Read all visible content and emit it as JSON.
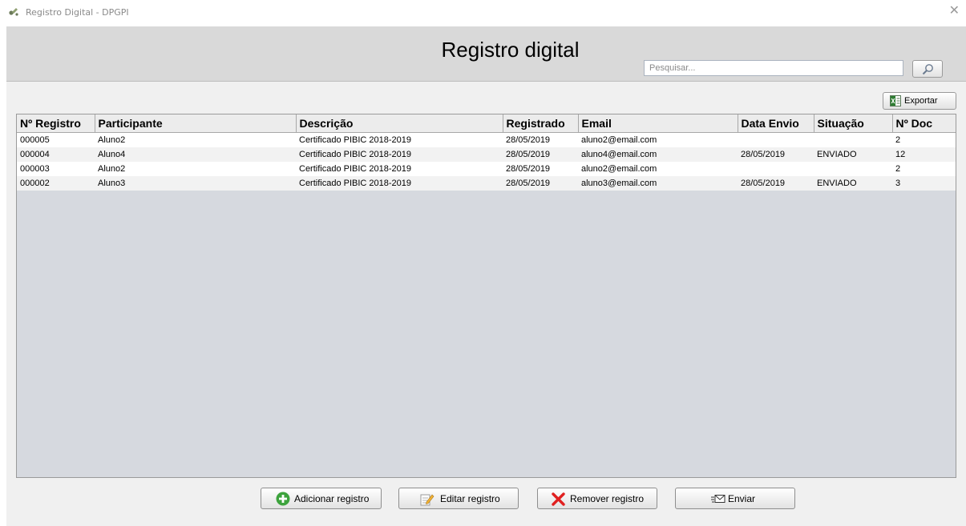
{
  "window": {
    "title": "Registro Digital - DPGPI",
    "heading": "Registro digital"
  },
  "search": {
    "placeholder": "Pesquisar...",
    "value": ""
  },
  "toolbar": {
    "export_label": "Exportar"
  },
  "table": {
    "columns": [
      "Nº Registro",
      "Participante",
      "Descrição",
      "Registrado",
      "Email",
      "Data Envio",
      "Situação",
      "Nº Doc"
    ],
    "rows": [
      [
        "000005",
        "Aluno2",
        "Certificado PIBIC 2018-2019",
        "28/05/2019",
        "aluno2@email.com",
        "",
        "",
        "2"
      ],
      [
        "000004",
        "Aluno4",
        "Certificado PIBIC 2018-2019",
        "28/05/2019",
        "aluno4@email.com",
        "28/05/2019",
        "ENVIADO",
        "12"
      ],
      [
        "000003",
        "Aluno2",
        "Certificado PIBIC 2018-2019",
        "28/05/2019",
        "aluno2@email.com",
        "",
        "",
        "2"
      ],
      [
        "000002",
        "Aluno3",
        "Certificado PIBIC 2018-2019",
        "28/05/2019",
        "aluno3@email.com",
        "28/05/2019",
        "ENVIADO",
        "3"
      ]
    ]
  },
  "actions": {
    "add_label": "Adicionar registro",
    "edit_label": "Editar registro",
    "remove_label": "Remover registro",
    "send_label": "Enviar"
  },
  "colors": {
    "header_bg": "#d9d9d9",
    "table_empty_bg": "#d6d9df",
    "add_icon": "#3da33d",
    "remove_icon": "#e02020"
  }
}
